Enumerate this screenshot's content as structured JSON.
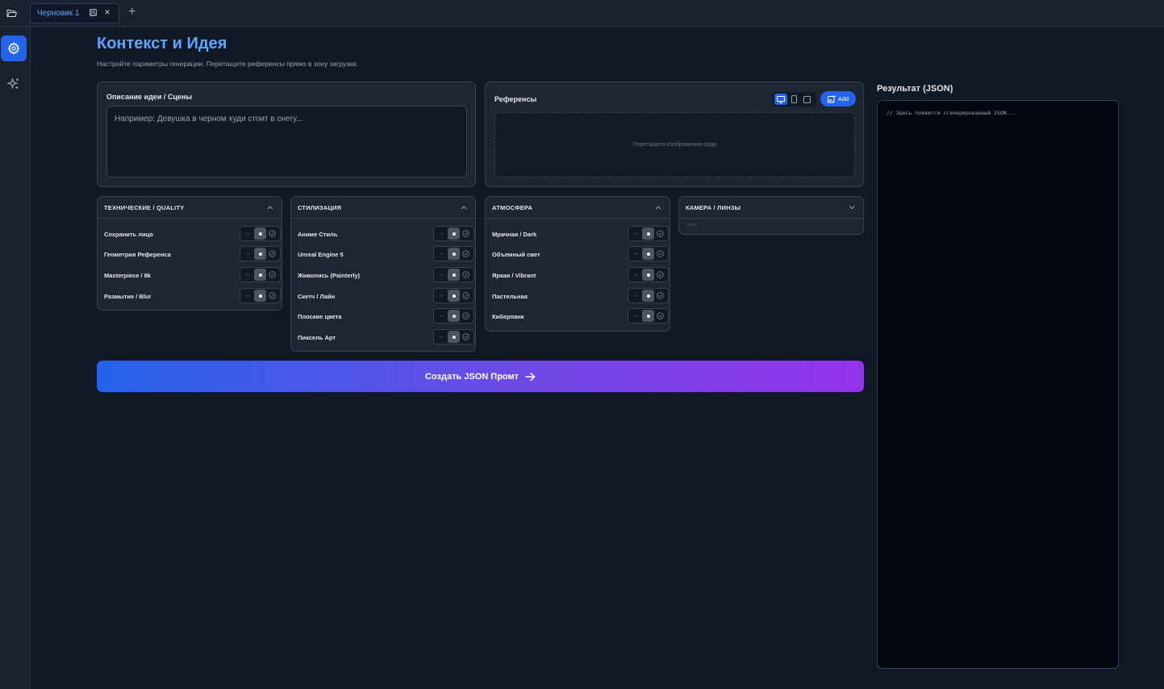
{
  "tabs": [
    {
      "label": "Черновик 1"
    }
  ],
  "header": {
    "title": "Контекст и Идея",
    "subtitle": "Настройте параметры генерации. Перетащите референсы прямо в зону загрузки."
  },
  "idea": {
    "title": "Описание идеи / Сцены",
    "placeholder": "Например: Девушка в черном худи стоит в снегу..."
  },
  "references": {
    "title": "Референсы",
    "add_label": "Add",
    "drop_hint": "Перетащите изображения сюда"
  },
  "panels": {
    "technical": {
      "title": "ТЕХНИЧЕСКИЕ / QUALITY",
      "items": [
        "Сохранить лицо",
        "Геометрия Референса",
        "Masterpiece / 8k",
        "Размытие / Blur"
      ]
    },
    "style": {
      "title": "СТИЛИЗАЦИЯ",
      "items": [
        "Аниме Стиль",
        "Unreal Engine 5",
        "Живопись (Painterly)",
        "Скетч / Лайн",
        "Плоские цвета",
        "Пиксель Арт"
      ]
    },
    "atmosphere": {
      "title": "АТМОСФЕРА",
      "items": [
        "Мрачная / Dark",
        "Объемный свет",
        "Яркая / Vibrant",
        "Пастельная",
        "Киберпанк"
      ]
    },
    "camera": {
      "title": "КАМЕРА / ЛИНЗЫ",
      "value": "Auto"
    }
  },
  "toggle_symbols": {
    "off": "–"
  },
  "generate": {
    "label": "Создать JSON Промт"
  },
  "result": {
    "title": "Результат (JSON)",
    "placeholder": "// Здесь появится сгенерированный JSON..."
  },
  "colors": {
    "accent": "#2563eb",
    "title_blue": "#60a5fa",
    "gradient_start": "#2563eb",
    "gradient_end": "#9333ea"
  }
}
